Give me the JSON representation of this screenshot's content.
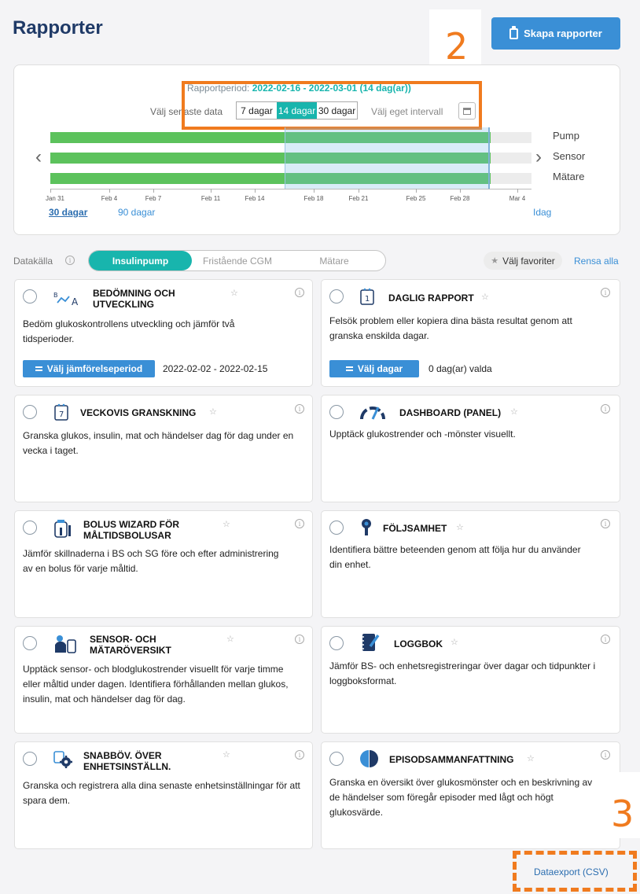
{
  "page": {
    "title": "Rapporter",
    "create_button": "Skapa rapporter"
  },
  "annotations": {
    "marker_2": "2",
    "marker_3": "3"
  },
  "timeline": {
    "period_label": "Rapportperiod:",
    "period_dates": "2022-02-16 - 2022-03-01 (14 dag(ar))",
    "choose_latest_label": "Välj senaste data",
    "segments": [
      "7 dagar",
      "14 dagar",
      "30 dagar"
    ],
    "selected_segment": "14 dagar",
    "custom_interval_label": "Välj eget intervall",
    "tracks": [
      {
        "name": "Pump",
        "coverage": 0.915
      },
      {
        "name": "Sensor",
        "coverage": 0.915
      },
      {
        "name": "Mätare",
        "coverage": 0.915
      }
    ],
    "axis_ticks": [
      "Jan 31",
      "Feb 4",
      "Feb 7",
      "Feb 11",
      "Feb 14",
      "Feb 18",
      "Feb 21",
      "Feb 25",
      "Feb 28",
      "Mar 4"
    ],
    "range_links": [
      "30 dagar",
      "90 dagar"
    ],
    "selected_range": "30 dagar",
    "today_link": "Idag"
  },
  "datasource": {
    "label": "Datakälla",
    "tabs": [
      "Insulinpump",
      "Fristående CGM",
      "Mätare"
    ],
    "selected_tab": "Insulinpump",
    "favorites_button": "Välj favoriter",
    "clear_all": "Rensa alla"
  },
  "reports": [
    {
      "title_lines": [
        "BEDÖMNING OCH",
        "UTVECKLING"
      ],
      "icon": "trend-comparison-icon",
      "description": "Bedöm glukoskontrollens utveckling och jämför två tidsperioder.",
      "action_button": "Välj jämförelseperiod",
      "action_value": "2022-02-02 - 2022-02-15"
    },
    {
      "title_lines": [
        "DAGLIG RAPPORT"
      ],
      "icon": "daily-calendar-icon",
      "description": "Felsök problem eller kopiera dina bästa resultat genom att granska enskilda dagar.",
      "action_button": "Välj dagar",
      "action_value": "0 dag(ar) valda"
    },
    {
      "title_lines": [
        "VECKOVIS GRANSKNING"
      ],
      "icon": "weekly-calendar-icon",
      "description": "Granska glukos, insulin, mat och händelser dag för dag under en vecka i taget."
    },
    {
      "title_lines": [
        "DASHBOARD (PANEL)"
      ],
      "icon": "gauge-icon",
      "description": "Upptäck glukostrender och -mönster visuellt."
    },
    {
      "title_lines": [
        "BOLUS WIZARD FÖR",
        "MÅLTIDSBOLUSAR"
      ],
      "icon": "bolus-wizard-icon",
      "description": "Jämför skillnaderna i BS och SG före och efter administrering av en bolus för varje måltid."
    },
    {
      "title_lines": [
        "FÖLJSAMHET"
      ],
      "icon": "adherence-icon",
      "description": "Identifiera bättre beteenden genom att följa hur du använder din enhet."
    },
    {
      "title_lines": [
        "SENSOR- OCH",
        "MÄTARÖVERSIKT"
      ],
      "icon": "sensor-meter-icon",
      "description": "Upptäck sensor- och blodglukostrender visuellt för varje timme eller måltid under dagen. Identifiera förhållanden mellan glukos, insulin, mat och händelser dag för dag."
    },
    {
      "title_lines": [
        "LOGGBOK"
      ],
      "icon": "logbook-icon",
      "description": "Jämför BS- och enhetsregistreringar över dagar och tidpunkter i loggboksformat."
    },
    {
      "title_lines": [
        "SNABBÖV. ÖVER",
        "ENHETSINSTÄLLN."
      ],
      "icon": "device-settings-icon",
      "description": "Granska och registrera alla dina senaste enhetsinställningar för att spara dem."
    },
    {
      "title_lines": [
        "EPISODSAMMANFATTNING"
      ],
      "icon": "episode-summary-icon",
      "description": "Granska en översikt över glukosmönster och en beskrivning av de händelser som föregår episoder med lågt och högt glukosvärde."
    }
  ],
  "export": {
    "label": "Dataexport (CSV)"
  }
}
